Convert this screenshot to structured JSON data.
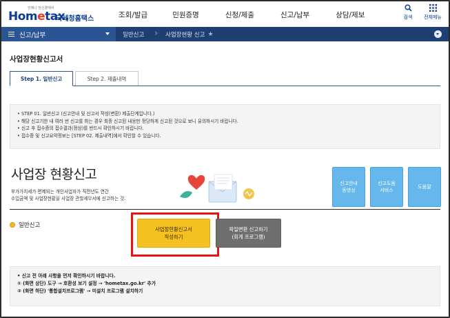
{
  "header": {
    "tagline": "언제나 당신곁에서",
    "brand_pre": "Hom",
    "brand_e": "e",
    "brand_post": "tax.",
    "agency": "국세청홈택스",
    "menu": [
      "조회/발급",
      "민원증명",
      "신청/제출",
      "신고/납부",
      "상담/제보"
    ],
    "search_label": "검색",
    "all_menu_label": "전체메뉴"
  },
  "navbar": {
    "section": "신고/납부",
    "crumb1": "일반신고",
    "crumb2": "사업장현황 신고"
  },
  "page": {
    "title": "사업장현황신고서",
    "tabs": [
      "Step 1. 일반신고",
      "Step 2. 제출내역"
    ]
  },
  "notice": {
    "lines": [
      "• STEP 01. 일반신고 (신고안내 및 신고서 작성(변환) 제출단계입니다.)",
      "• 해당 신고기한 내 여러 번 신고를 하는 경우 최종 신고된 내용만 정당하게 신고된 것으로 보니 유의하시기 바랍니다.",
      "• 신고 후 접수증의 접수결과(정상)를 반드시 확인하시기 바랍니다.",
      "• 접수증 및 신고요약정보는 [STEP 02. 제출내역]에서 확인할 수 있습니다."
    ]
  },
  "main": {
    "title": "사업장 현황신고",
    "desc1": "부가가치세가 면제되는 개인사업자가 직전년도 연간",
    "desc2": "수입금액 및 사업장현황을 사업장 관할세무서에 신고하는 것."
  },
  "help": {
    "b1_l1": "신고안내",
    "b1_l2": "동영상",
    "b2_l1": "신고도움",
    "b2_l2": "서비스",
    "b3": "도움말"
  },
  "section": {
    "label": "일반신고",
    "write_l1": "사업장현황신고서",
    "write_l2": "작성하기",
    "file_l1": "파일변환 신고하기",
    "file_l2": "(회계 프로그램)"
  },
  "notice2": {
    "lines": [
      "• 신고 전 아래 사항을 먼저 확인하시기 바랍니다.",
      "① (화면 상단) 도구 → 호환성 보기 설정 → 'hometax.go.kr' 추가",
      "② (화면 하단) '통합설치프로그램' → 미설치 프로그램 설치하기"
    ]
  },
  "colors": {
    "brand": "#0b3d91",
    "navbar": "#1f3f73",
    "help_button": "#66b8ec",
    "primary_button": "#f5c120",
    "secondary_button": "#6f6f6f",
    "highlight": "#e8130f"
  }
}
